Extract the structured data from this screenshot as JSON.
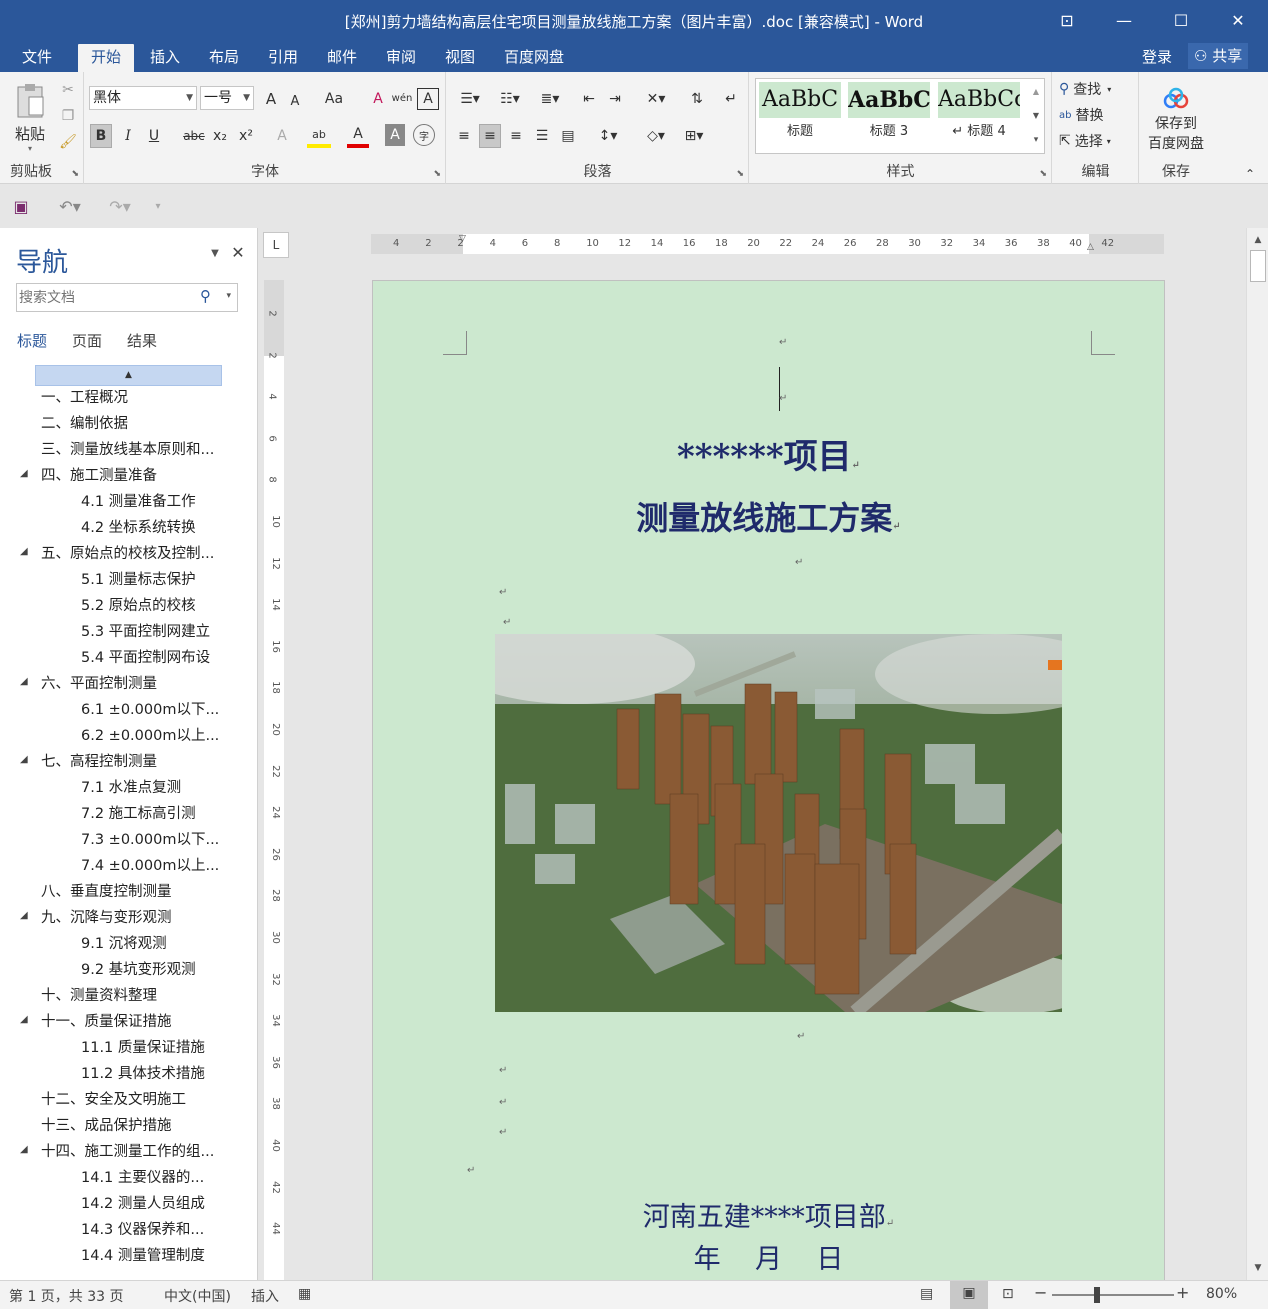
{
  "window": {
    "title": "[郑州]剪力墙结构高层住宅项目测量放线施工方案（图片丰富）.doc [兼容模式] - Word",
    "controls": {
      "ribbon_display": "⊡",
      "minimize": "—",
      "maximize": "☐",
      "close": "✕"
    }
  },
  "menu": {
    "tabs": [
      "文件",
      "开始",
      "插入",
      "布局",
      "引用",
      "邮件",
      "审阅",
      "视图",
      "百度网盘"
    ],
    "active": "开始",
    "login": "登录",
    "share": "共享"
  },
  "ribbon": {
    "clipboard": {
      "label": "剪贴板",
      "paste": "粘贴"
    },
    "font": {
      "label": "字体",
      "family": "黑体",
      "size": "一号",
      "grow": "A",
      "shrink": "A",
      "case": "Aa",
      "clear": "A",
      "phonetic": "wén",
      "border": "A",
      "bold": "B",
      "italic": "I",
      "underline": "U",
      "strike": "abc",
      "sub": "x₂",
      "sup": "x²",
      "effects": "A",
      "highlight": "ab",
      "color": "A",
      "shading": "A",
      "enclose": "字"
    },
    "paragraph": {
      "label": "段落"
    },
    "styles": {
      "label": "样式",
      "items": [
        {
          "preview": "AaBbC",
          "name": "标题"
        },
        {
          "preview": "AaBbC",
          "name": "标题 3"
        },
        {
          "preview": "AaBbCc",
          "name": "↵ 标题 4"
        }
      ]
    },
    "editing": {
      "label": "编辑",
      "find": "查找",
      "replace": "替换",
      "select": "选择"
    },
    "save": {
      "label": "保存",
      "button_line1": "保存到",
      "button_line2": "百度网盘"
    }
  },
  "navigation": {
    "title": "导航",
    "search_placeholder": "搜索文档",
    "tabs": [
      "标题",
      "页面",
      "结果"
    ],
    "active_tab": "标题",
    "items": [
      {
        "text": "一、工程概况",
        "level": 1,
        "expandable": false
      },
      {
        "text": "二、编制依据",
        "level": 1,
        "expandable": false
      },
      {
        "text": "三、测量放线基本原则和...",
        "level": 1,
        "expandable": false
      },
      {
        "text": "四、施工测量准备",
        "level": 1,
        "expandable": true
      },
      {
        "text": "4.1  测量准备工作",
        "level": 2,
        "expandable": false
      },
      {
        "text": "4.2  坐标系统转换",
        "level": 2,
        "expandable": false
      },
      {
        "text": "五、原始点的校核及控制...",
        "level": 1,
        "expandable": true
      },
      {
        "text": "5.1  测量标志保护",
        "level": 2,
        "expandable": false
      },
      {
        "text": "5.2  原始点的校核",
        "level": 2,
        "expandable": false
      },
      {
        "text": "5.3  平面控制网建立",
        "level": 2,
        "expandable": false
      },
      {
        "text": "5.4  平面控制网布设",
        "level": 2,
        "expandable": false
      },
      {
        "text": "六、平面控制测量",
        "level": 1,
        "expandable": true
      },
      {
        "text": "6.1  ±0.000m以下...",
        "level": 2,
        "expandable": false
      },
      {
        "text": "6.2  ±0.000m以上...",
        "level": 2,
        "expandable": false
      },
      {
        "text": "七、高程控制测量",
        "level": 1,
        "expandable": true
      },
      {
        "text": "7.1  水准点复测",
        "level": 2,
        "expandable": false
      },
      {
        "text": "7.2  施工标高引测",
        "level": 2,
        "expandable": false
      },
      {
        "text": "7.3  ±0.000m以下...",
        "level": 2,
        "expandable": false
      },
      {
        "text": "7.4  ±0.000m以上...",
        "level": 2,
        "expandable": false
      },
      {
        "text": "八、垂直度控制测量",
        "level": 1,
        "expandable": false
      },
      {
        "text": "九、沉降与变形观测",
        "level": 1,
        "expandable": true
      },
      {
        "text": "9.1  沉将观测",
        "level": 2,
        "expandable": false
      },
      {
        "text": "9.2  基坑变形观测",
        "level": 2,
        "expandable": false
      },
      {
        "text": "十、测量资料整理",
        "level": 1,
        "expandable": false
      },
      {
        "text": "十一、质量保证措施",
        "level": 1,
        "expandable": true
      },
      {
        "text": "11.1  质量保证措施",
        "level": 2,
        "expandable": false
      },
      {
        "text": "11.2  具体技术措施",
        "level": 2,
        "expandable": false
      },
      {
        "text": "十二、安全及文明施工",
        "level": 1,
        "expandable": false
      },
      {
        "text": "十三、成品保护措施",
        "level": 1,
        "expandable": false
      },
      {
        "text": "十四、施工测量工作的组...",
        "level": 1,
        "expandable": true
      },
      {
        "text": "14.1  主要仪器的...",
        "level": 2,
        "expandable": false
      },
      {
        "text": "14.2  测量人员组成",
        "level": 2,
        "expandable": false
      },
      {
        "text": "14.3  仪器保养和...",
        "level": 2,
        "expandable": false
      },
      {
        "text": "14.4  测量管理制度",
        "level": 2,
        "expandable": false
      }
    ]
  },
  "ruler": {
    "horizontal": [
      "4",
      "2",
      "2",
      "4",
      "6",
      "8",
      "10",
      "12",
      "14",
      "16",
      "18",
      "20",
      "22",
      "24",
      "26",
      "28",
      "30",
      "32",
      "34",
      "36",
      "38",
      "40",
      "42"
    ],
    "vertical": [
      "2",
      "2",
      "4",
      "6",
      "8",
      "10",
      "12",
      "14",
      "16",
      "18",
      "20",
      "22",
      "24",
      "26",
      "28",
      "30",
      "32",
      "34",
      "36",
      "38",
      "40",
      "42",
      "44"
    ],
    "corner": "L"
  },
  "document": {
    "title_line1": "******项目",
    "title_line2": "测量放线施工方案",
    "org": "河南五建****项目部",
    "date": "年    月    日",
    "para_mark": "↵"
  },
  "status": {
    "page": "第 1 页，共 33 页",
    "language": "中文(中国)",
    "mode": "插入",
    "zoom": "80%"
  },
  "colors": {
    "brand": "#2b579a",
    "page": "#cce8cf",
    "heading": "#1f2a6b"
  }
}
